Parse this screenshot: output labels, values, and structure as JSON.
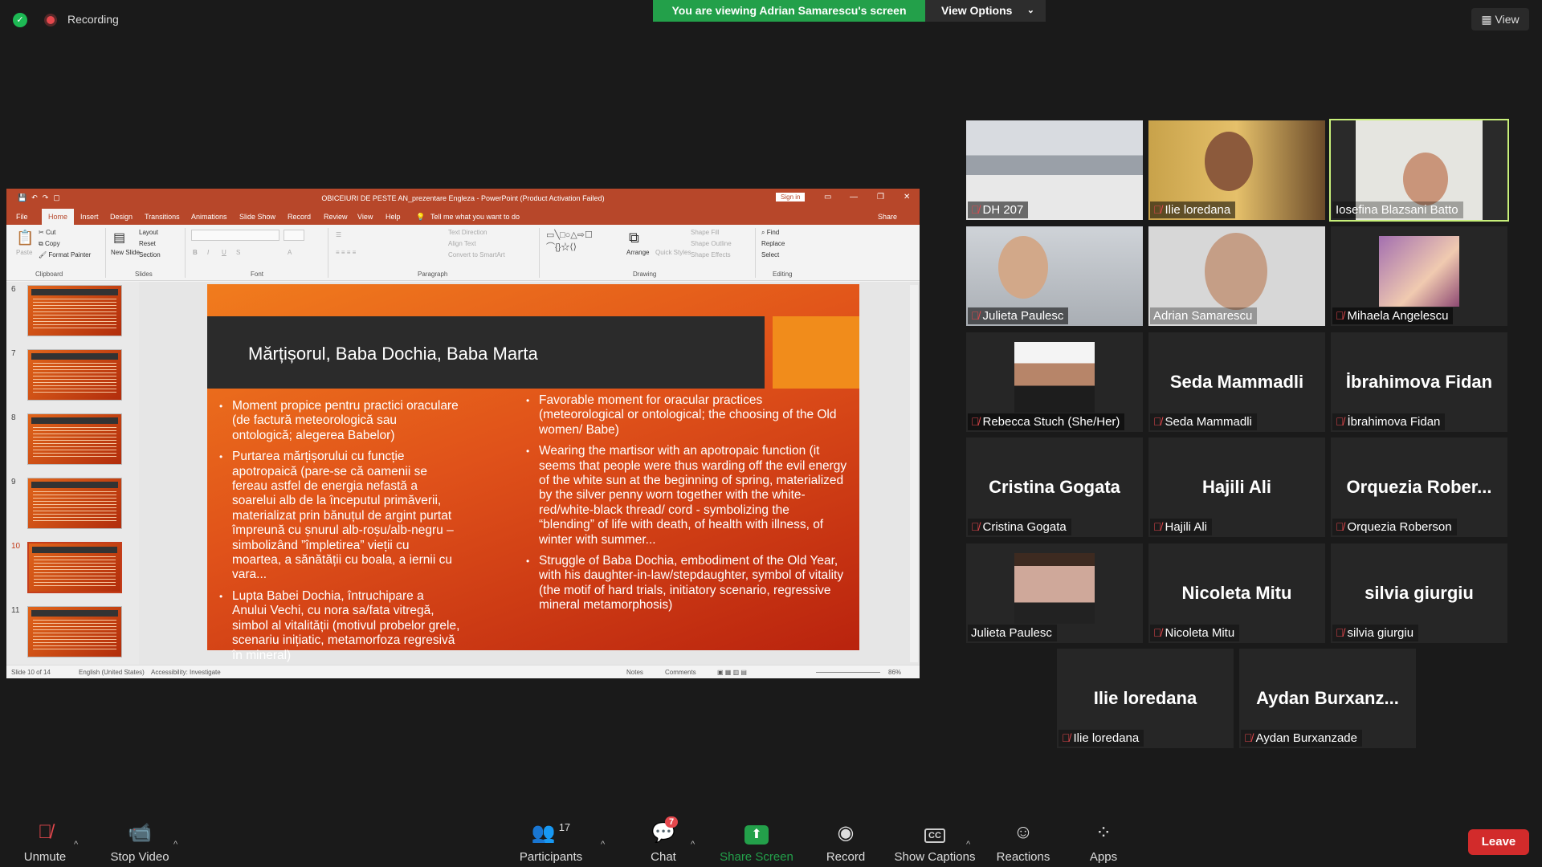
{
  "topbar": {
    "recording_label": "Recording",
    "viewing_banner": "You are viewing Adrian Samarescu's screen",
    "view_options_label": "View Options",
    "view_button_label": "View"
  },
  "ppt": {
    "window_title": "OBICEIURI DE PESTE AN_prezentare Engleza  -  PowerPoint (Product Activation Failed)",
    "sign_in": "Sign in",
    "share": "Share",
    "tabs": [
      "File",
      "Home",
      "Insert",
      "Design",
      "Transitions",
      "Animations",
      "Slide Show",
      "Record",
      "Review",
      "View",
      "Help"
    ],
    "tell_me": "Tell me what you want to do",
    "ribbon": {
      "clipboard": {
        "group": "Clipboard",
        "paste": "Paste",
        "cut": "Cut",
        "copy": "Copy",
        "format_painter": "Format Painter"
      },
      "slides": {
        "group": "Slides",
        "new_slide": "New Slide",
        "layout": "Layout",
        "reset": "Reset",
        "section": "Section"
      },
      "font": {
        "group": "Font"
      },
      "paragraph": {
        "group": "Paragraph",
        "text_direction": "Text Direction",
        "align_text": "Align Text",
        "convert": "Convert to SmartArt"
      },
      "drawing": {
        "group": "Drawing",
        "arrange": "Arrange",
        "quick_styles": "Quick Styles",
        "shape_fill": "Shape Fill",
        "shape_outline": "Shape Outline",
        "shape_effects": "Shape Effects"
      },
      "editing": {
        "group": "Editing",
        "find": "Find",
        "replace": "Replace",
        "select": "Select"
      }
    },
    "thumbnails": [
      "6",
      "7",
      "8",
      "9",
      "10",
      "11"
    ],
    "selected_thumbnail": "10",
    "slide": {
      "title": "Mărțișorul, Baba Dochia, Baba Marta",
      "left_bullets": [
        "Moment propice pentru practici oraculare (de factură meteorologică sau ontologică; alegerea Babelor)",
        "Purtarea mărțișorului cu funcție apotropaică (pare-se că oamenii se fereau astfel de energia nefastă a soarelui alb de la începutul primăverii, materializat prin bănuțul de argint purtat împreună cu șnurul alb-roșu/alb-negru – simbolizând ”împletirea” vieții cu moartea, a sănătății cu boala, a iernii cu vara...",
        "Lupta Babei Dochia, întruchipare a Anului Vechi, cu nora sa/fata vitregă, simbol al vitalității (motivul probelor grele, scenariu inițiatic, metamorfoza regresivă în mineral)"
      ],
      "right_bullets": [
        "Favorable moment for oracular practices (meteorological or ontological; the choosing of the Old women/ Babe)",
        "Wearing the martisor with an apotropaic function (it seems that people were thus warding off the evil energy of the white sun at the beginning of spring, materialized by the silver penny worn together with the white-red/white-black thread/ cord - symbolizing the “blending” of life with death, of health with illness, of winter with summer...",
        "Struggle of Baba Dochia, embodiment of the Old Year, with his daughter-in-law/stepdaughter, symbol of vitality (the motif of hard trials, initiatory scenario, regressive mineral metamorphosis)"
      ]
    },
    "status": {
      "slide_of": "Slide 10 of 14",
      "language": "English (United States)",
      "accessibility": "Accessibility: Investigate",
      "notes": "Notes",
      "comments": "Comments",
      "zoom": "86%"
    }
  },
  "participants": [
    {
      "name": "DH 207",
      "type": "video"
    },
    {
      "name": "Ilie loredana",
      "type": "video"
    },
    {
      "name": "Iosefina Blazsani Batto",
      "type": "video",
      "active": true
    },
    {
      "name": "Julieta Paulesc",
      "type": "video"
    },
    {
      "name": "Adrian Samarescu",
      "type": "video"
    },
    {
      "name": "Mihaela Angelescu",
      "type": "photo"
    },
    {
      "name": "Rebecca Stuch (She/Her)",
      "type": "photo"
    },
    {
      "name": "Seda Mammadli",
      "display": "Seda Mammadli",
      "type": "name"
    },
    {
      "name": "İbrahimova Fidan",
      "display": "İbrahimova Fidan",
      "type": "name"
    },
    {
      "name": "Cristina Gogata",
      "display": "Cristina Gogata",
      "type": "name"
    },
    {
      "name": "Hajili Ali",
      "display": "Hajili Ali",
      "type": "name"
    },
    {
      "name": "Orquezia Roberson",
      "display": "Orquezia  Rober...",
      "type": "name"
    },
    {
      "name": "Julieta Paulesc",
      "type": "photo"
    },
    {
      "name": "Nicoleta Mitu",
      "display": "Nicoleta Mitu",
      "type": "name"
    },
    {
      "name": "silvia giurgiu",
      "display": "silvia giurgiu",
      "type": "name"
    },
    {
      "name": "Ilie loredana",
      "display": "Ilie loredana",
      "type": "name"
    },
    {
      "name": "Aydan Burxanzade",
      "display": "Aydan Burxanz...",
      "type": "name"
    }
  ],
  "toolbar": {
    "unmute": "Unmute",
    "stop_video": "Stop Video",
    "participants": "Participants",
    "participants_count": "17",
    "chat": "Chat",
    "chat_badge": "7",
    "share_screen": "Share Screen",
    "record": "Record",
    "show_captions": "Show Captions",
    "reactions": "Reactions",
    "apps": "Apps",
    "leave": "Leave"
  },
  "colors": {
    "banner_green": "#23a04a",
    "ppt_red": "#b7472a",
    "leave_red": "#d22b2b",
    "active_speaker": "#c8f07a"
  }
}
